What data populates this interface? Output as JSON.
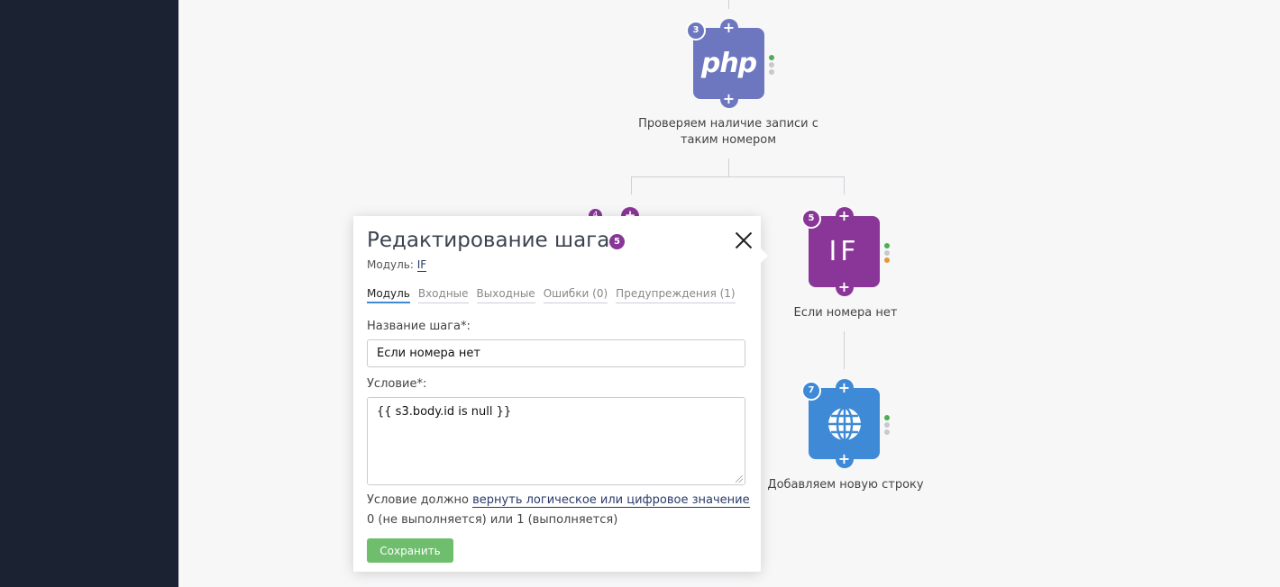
{
  "nodes": {
    "php": {
      "badge": "3",
      "icon_text": "php",
      "label": "Проверяем наличие записи с таким номером"
    },
    "if": {
      "badge": "5",
      "icon_text": "IF",
      "label": "Если номера нет"
    },
    "web": {
      "badge": "7",
      "icon": "globe-icon",
      "label": "Добавляем новую строку"
    },
    "hidden_badge": "4",
    "plus_symbol": "+"
  },
  "modal": {
    "title": "Редактирование шага",
    "title_badge": "5",
    "module_label": "Модуль:",
    "module_value": "IF",
    "tabs": [
      "Модуль",
      "Входные",
      "Выходные",
      "Ошибки (0)",
      "Предупреждения (1)"
    ],
    "active_tab": "Модуль",
    "name_label": "Название шага*:",
    "name_value": "Если номера нет",
    "condition_label": "Условие*:",
    "condition_value": "{{ s3.body.id is null }}",
    "hint_prefix": "Условие должно",
    "hint_link": "вернуть логическое или цифровое значение",
    "hint_suffix": "0 (не выполняется) или 1 (выполняется)",
    "save_label": "Сохранить"
  },
  "colors": {
    "sidebar": "#1b2232",
    "php": "#6d77bf",
    "if": "#8a3698",
    "web": "#3e8ad6",
    "save": "#6ebe6e",
    "status_ok": "#4caf50",
    "status_warn": "#e09a3a"
  }
}
